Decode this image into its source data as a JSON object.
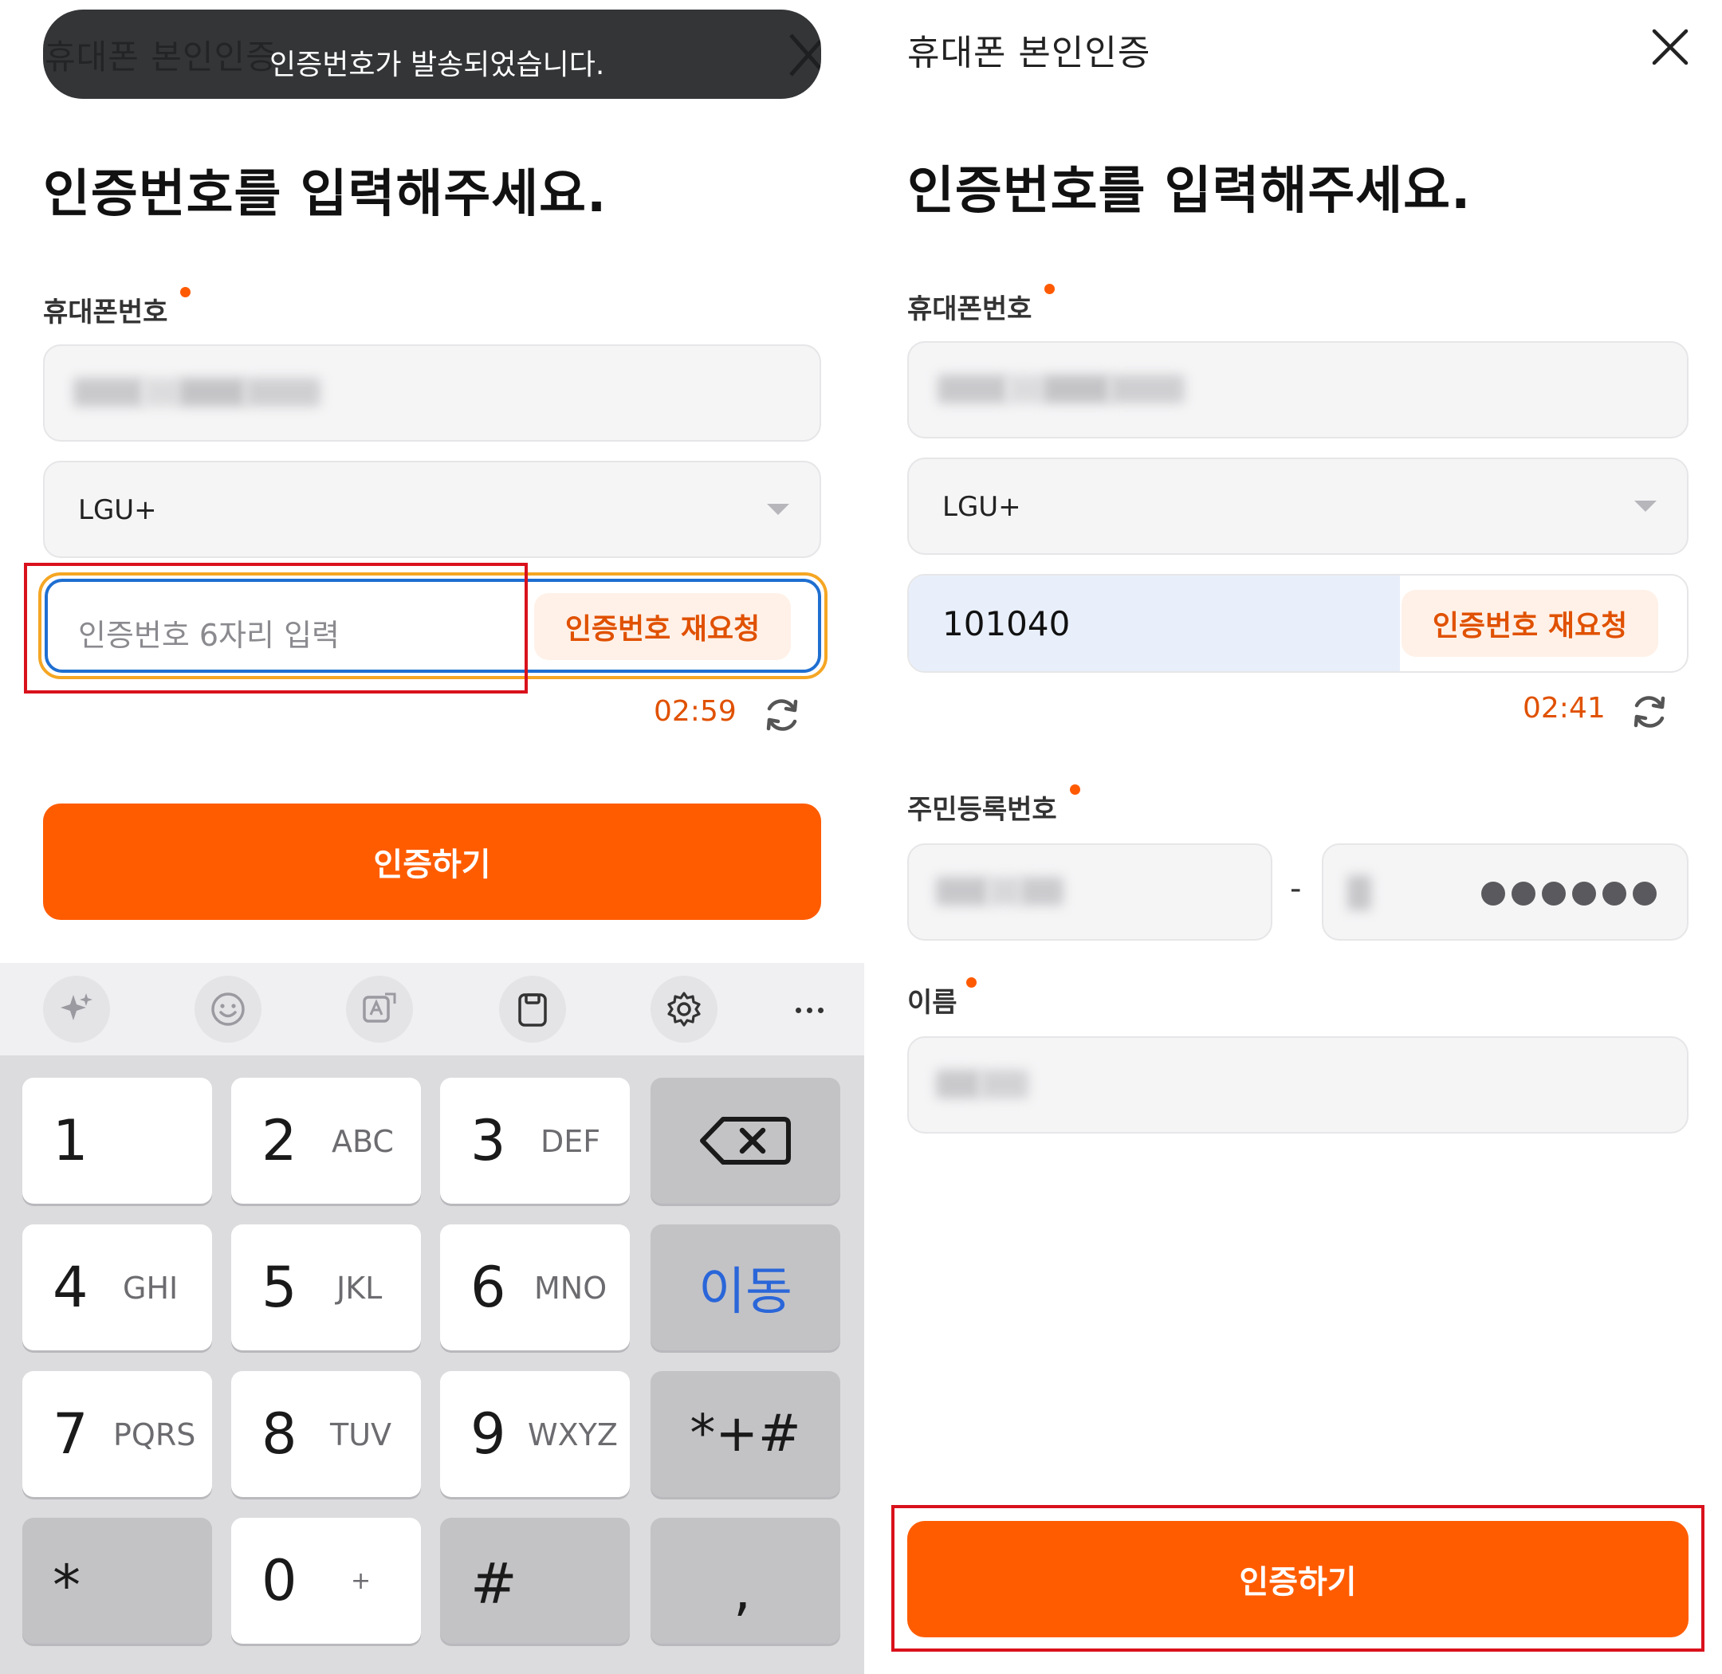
{
  "left": {
    "toast": {
      "ghost_title": "휴대폰 본인인증",
      "message": "인증번호가 발송되었습니다."
    },
    "heading": "인증번호를 입력해주세요.",
    "phone_label": "휴대폰번호",
    "carrier": "LGU+",
    "code_placeholder": "인증번호 6자리 입력",
    "resend_label": "인증번호 재요청",
    "timer": "02:59",
    "submit_label": "인증하기",
    "keyboard": {
      "toolbar_icons": [
        "sparkle-icon",
        "emoji-icon",
        "translate-icon",
        "clipboard-icon",
        "gear-icon",
        "more-icon"
      ],
      "keys": {
        "k1": {
          "num": "1",
          "sub": ""
        },
        "k2": {
          "num": "2",
          "sub": "ABC"
        },
        "k3": {
          "num": "3",
          "sub": "DEF"
        },
        "k4": {
          "num": "4",
          "sub": "GHI"
        },
        "k5": {
          "num": "5",
          "sub": "JKL"
        },
        "k6": {
          "num": "6",
          "sub": "MNO"
        },
        "k7": {
          "num": "7",
          "sub": "PQRS"
        },
        "k8": {
          "num": "8",
          "sub": "TUV"
        },
        "k9": {
          "num": "9",
          "sub": "WXYZ"
        },
        "k0": {
          "num": "0",
          "sub": "+"
        },
        "move": "이동",
        "symbols": "*+#",
        "star": "*",
        "hash": "#",
        "comma": ","
      }
    }
  },
  "right": {
    "title": "휴대폰 본인인증",
    "heading": "인증번호를 입력해주세요.",
    "phone_label": "휴대폰번호",
    "carrier": "LGU+",
    "code_value": "101040",
    "resend_label": "인증번호 재요청",
    "timer": "02:41",
    "rrn_label": "주민등록번호",
    "rrn_dash": "-",
    "name_label": "이름",
    "submit_label": "인증하기"
  },
  "colors": {
    "accent": "#ff5c00",
    "timer": "#e05100",
    "highlight_frame": "#d9111c",
    "focus_border": "#1f6fd1"
  }
}
